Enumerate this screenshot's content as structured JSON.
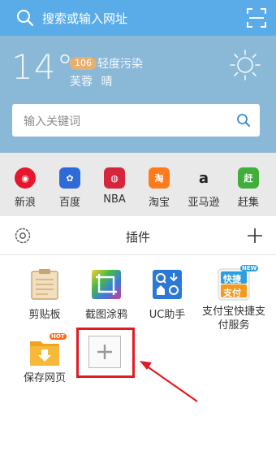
{
  "search_bar": {
    "placeholder": "搜索或输入网址",
    "icon": "search-icon",
    "scan_icon": "scan-icon"
  },
  "weather": {
    "temperature": "14°",
    "aqi_value": "106",
    "aqi_label": "轻度污染",
    "city": "芙蓉",
    "condition": "晴",
    "icon": "sun-icon"
  },
  "keyword_search": {
    "placeholder": "输入关键词"
  },
  "quick_sites": [
    {
      "label": "新浪",
      "color": "#e6162d",
      "glyph": "◉"
    },
    {
      "label": "百度",
      "color": "#2f6bd8",
      "glyph": "✿"
    },
    {
      "label": "NBA",
      "color": "#d6263c",
      "glyph": "◍"
    },
    {
      "label": "淘宝",
      "color": "#ff7a1a",
      "glyph": "淘"
    },
    {
      "label": "亚马逊",
      "color": "#ffffff",
      "glyph": "a"
    },
    {
      "label": "赶集",
      "color": "#3fae3a",
      "glyph": "赶"
    }
  ],
  "plugins_panel": {
    "title": "插件",
    "items": [
      {
        "name": "剪贴板",
        "icon": "clipboard-icon"
      },
      {
        "name": "截图涂鸦",
        "icon": "screenshot-icon"
      },
      {
        "name": "UC助手",
        "icon": "uc-helper-icon"
      },
      {
        "name": "支付宝快捷支付服务",
        "icon": "alipay-icon",
        "badge": "NEW",
        "icon_text": "快捷",
        "icon_text2": "支付"
      },
      {
        "name": "保存网页",
        "icon": "save-page-icon",
        "badge": "HOT"
      }
    ],
    "add_icon": "plus-icon"
  },
  "colors": {
    "topbar": "#5aace8",
    "weather_bg": "#8ab9d8",
    "highlight": "#e21a22"
  }
}
